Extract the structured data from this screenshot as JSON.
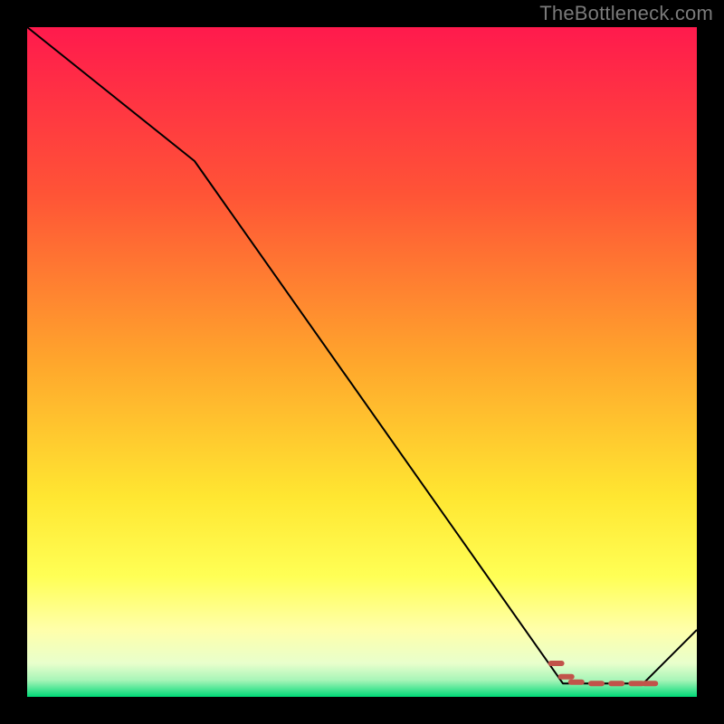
{
  "attribution": "TheBottleneck.com",
  "chart_data": {
    "type": "line",
    "title": "",
    "xlabel": "",
    "ylabel": "",
    "xlim": [
      0,
      100
    ],
    "ylim": [
      0,
      100
    ],
    "background_gradient_stops": [
      {
        "offset": 0.0,
        "color": "#ff1a4d"
      },
      {
        "offset": 0.25,
        "color": "#ff5436"
      },
      {
        "offset": 0.5,
        "color": "#ffa62c"
      },
      {
        "offset": 0.7,
        "color": "#ffe631"
      },
      {
        "offset": 0.82,
        "color": "#ffff55"
      },
      {
        "offset": 0.9,
        "color": "#ffffaa"
      },
      {
        "offset": 0.95,
        "color": "#e8ffcc"
      },
      {
        "offset": 0.975,
        "color": "#a8f5b8"
      },
      {
        "offset": 1.0,
        "color": "#00d977"
      }
    ],
    "series": [
      {
        "name": "bottleneck-curve",
        "x": [
          0,
          25,
          80,
          92,
          100
        ],
        "y": [
          100,
          80,
          2,
          2,
          10
        ],
        "stroke": "#000000",
        "stroke_width": 2
      },
      {
        "name": "optimal-band-marker",
        "x": [
          79,
          80.5,
          82,
          85,
          88,
          91,
          93
        ],
        "y": [
          5,
          3,
          2.2,
          2,
          2,
          2,
          2
        ],
        "stroke": "#c1534a",
        "stroke_width": 6,
        "dashed": true
      }
    ]
  }
}
